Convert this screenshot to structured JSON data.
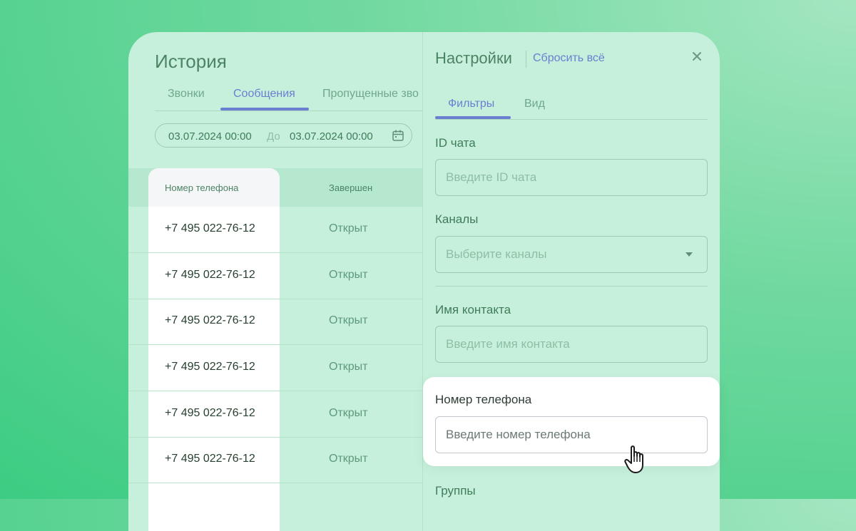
{
  "history": {
    "title": "История",
    "tabs": [
      {
        "label": "Звонки",
        "active": false
      },
      {
        "label": "Сообщения",
        "active": true
      },
      {
        "label": "Пропущенные зво",
        "active": false
      }
    ],
    "date_from": "03.07.2024 00:00",
    "date_sep": "До",
    "date_to": "03.07.2024 00:00",
    "columns": [
      "Номер телефона",
      "Завершен"
    ],
    "rows": [
      {
        "phone": "+7 495 022-76-12",
        "status": "Открыт"
      },
      {
        "phone": "+7 495 022-76-12",
        "status": "Открыт"
      },
      {
        "phone": "+7 495 022-76-12",
        "status": "Открыт"
      },
      {
        "phone": "+7 495 022-76-12",
        "status": "Открыт"
      },
      {
        "phone": "+7 495 022-76-12",
        "status": "Открыт"
      },
      {
        "phone": "+7 495 022-76-12",
        "status": "Открыт"
      }
    ]
  },
  "settings": {
    "title": "Настройки",
    "reset_label": "Сбросить всё",
    "tabs": [
      {
        "label": "Фильтры",
        "active": true
      },
      {
        "label": "Вид",
        "active": false
      }
    ],
    "filters": {
      "chat_id": {
        "label": "ID чата",
        "placeholder": "Введите ID чата"
      },
      "channels": {
        "label": "Каналы",
        "placeholder": "Выберите каналы"
      },
      "contact_name": {
        "label": "Имя контакта",
        "placeholder": "Введите имя контакта"
      },
      "phone": {
        "label": "Номер телефона",
        "placeholder": "Введите номер телефона"
      },
      "groups": {
        "label": "Группы"
      }
    }
  },
  "colors": {
    "accent": "#6a7fd1",
    "card_bg": "#c6f0dc",
    "text_green": "#4c8363"
  },
  "icons": [
    "calendar-icon",
    "close-icon",
    "chevron-down-icon",
    "hand-pointer-cursor-icon"
  ]
}
